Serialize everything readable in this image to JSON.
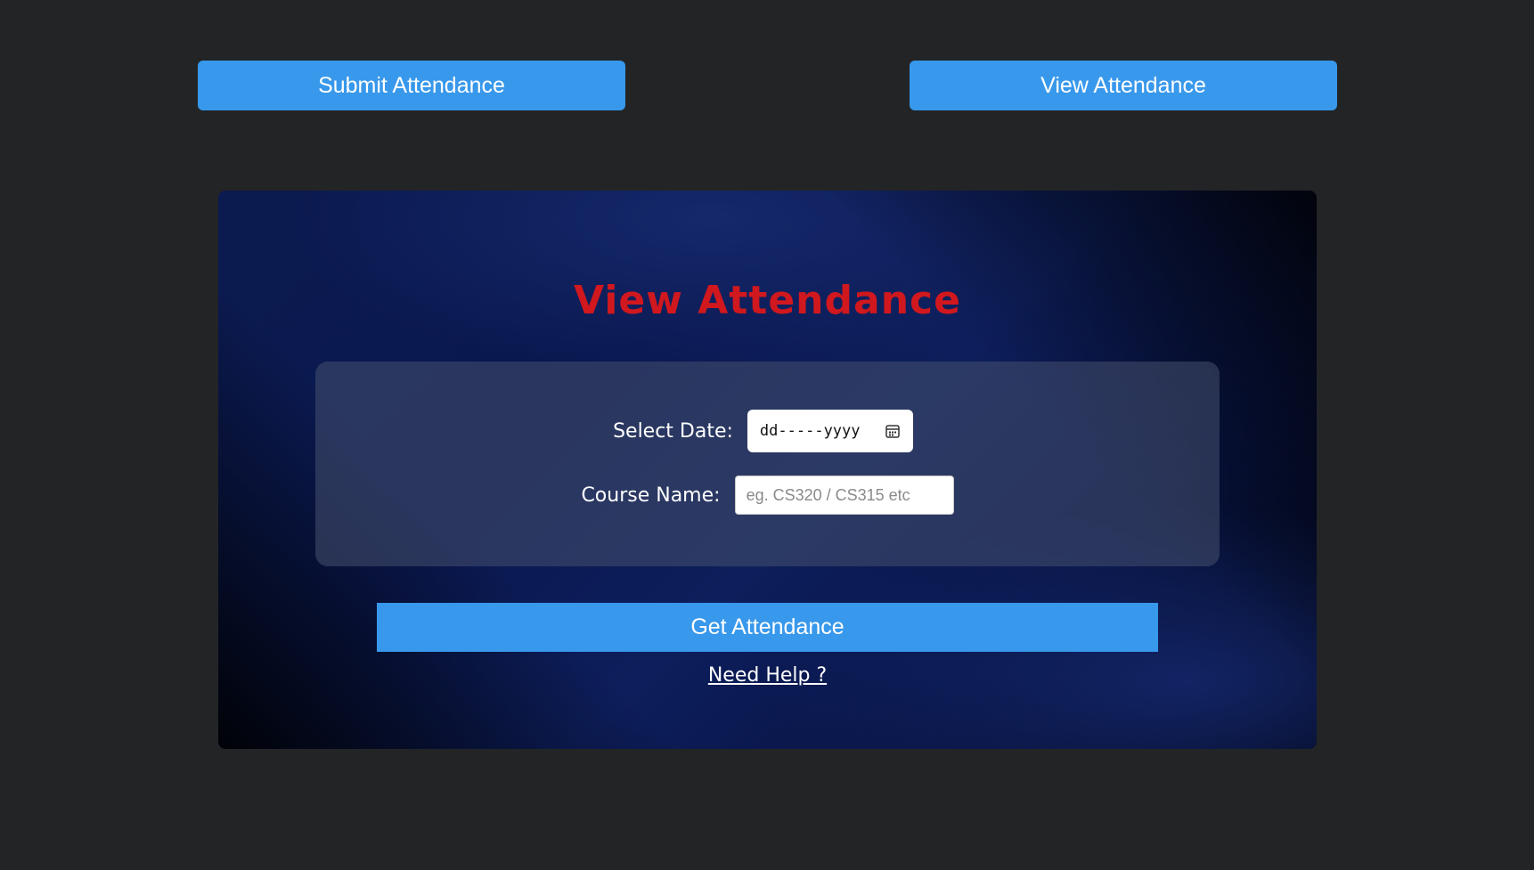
{
  "nav": {
    "submit_label": "Submit Attendance",
    "view_label": "View Attendance"
  },
  "card": {
    "title": "View Attendance",
    "date_label": "Select Date:",
    "date_value": "dd-----yyyy",
    "course_label": "Course Name:",
    "course_placeholder": "eg. CS320 / CS315 etc",
    "course_value": "",
    "submit_label": "Get Attendance",
    "help_label": "Need Help ?"
  },
  "icons": {
    "date_picker": "calendar-icon"
  },
  "colors": {
    "accent": "#3898eb",
    "title": "#d0181e",
    "background": "#232426"
  }
}
